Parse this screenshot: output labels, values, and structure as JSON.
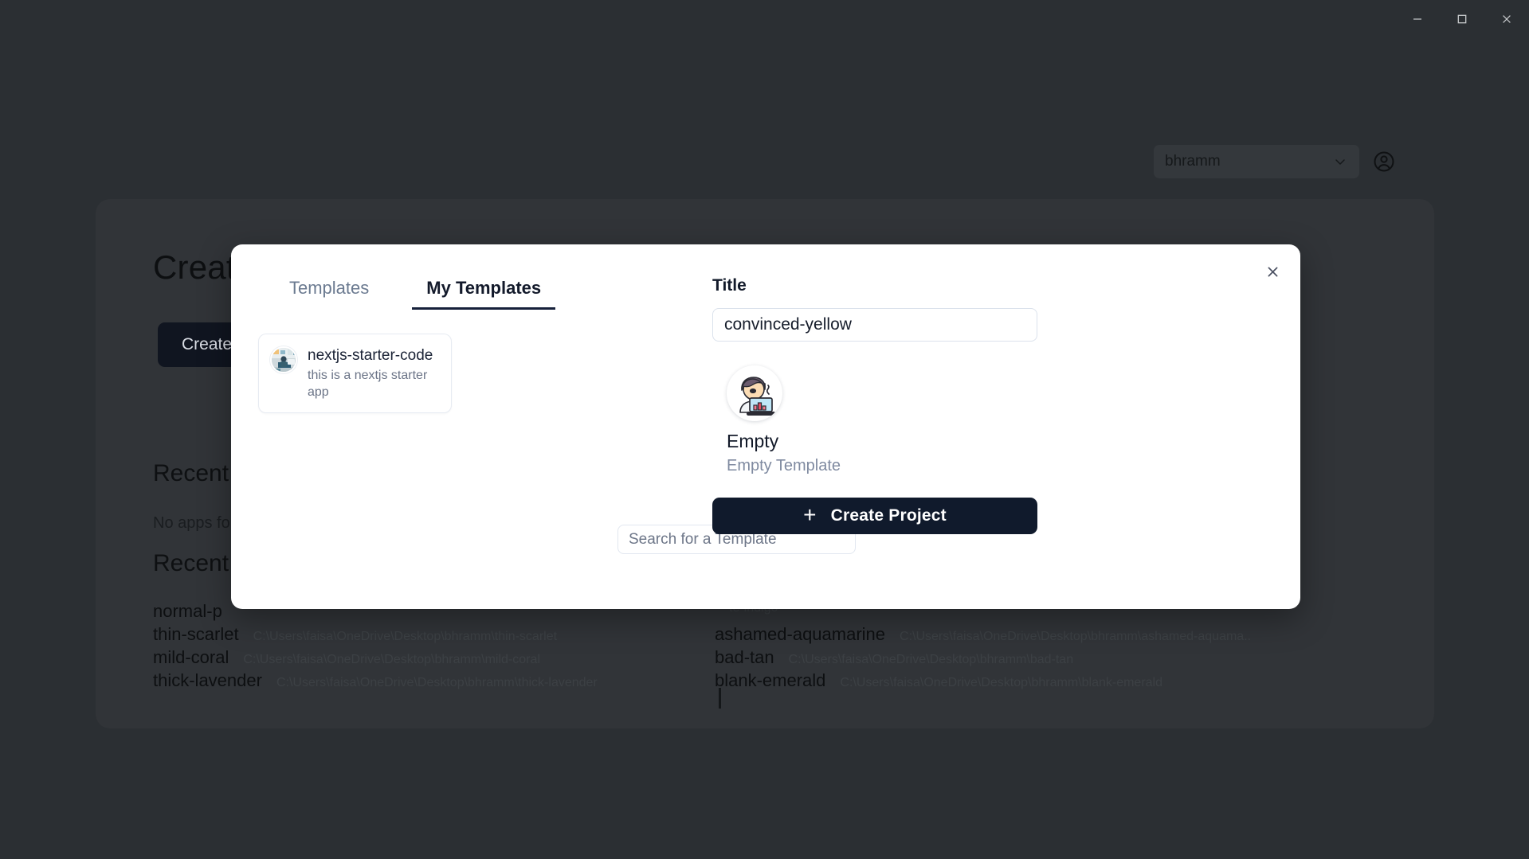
{
  "window": {
    "controls": [
      {
        "name": "minimize",
        "glyph": "minimize-icon"
      },
      {
        "name": "maximize",
        "glyph": "maximize-icon"
      },
      {
        "name": "close",
        "glyph": "close-icon"
      }
    ]
  },
  "account": {
    "org_name": "bhramm",
    "chevron": "chevron-down-icon",
    "avatar": "account-circle-icon"
  },
  "background": {
    "page_title": "Create",
    "create_button_label": "Create",
    "recent_apps_heading": "Recent",
    "no_apps_text": "No apps fo",
    "recent_projects_heading": "Recent",
    "projects_left": [
      {
        "name": "normal-p",
        "path": ""
      },
      {
        "name": "thin-scarlet",
        "path": "C:\\Users\\faisa\\OneDrive\\Desktop\\bhramm\\thin-scarlet"
      },
      {
        "name": "mild-coral",
        "path": "C:\\Users\\faisa\\OneDrive\\Desktop\\bhramm\\mild-coral"
      },
      {
        "name": "thick-lavender",
        "path": "C:\\Users\\faisa\\OneDrive\\Desktop\\bhramm\\thick-lavender"
      }
    ],
    "projects_right": [
      {
        "name": "",
        "path": "te-indigo"
      },
      {
        "name": "ashamed-aquamarine",
        "path": "C:\\Users\\faisa\\OneDrive\\Desktop\\bhramm\\ashamed-aquama.."
      },
      {
        "name": "bad-tan",
        "path": "C:\\Users\\faisa\\OneDrive\\Desktop\\bhramm\\bad-tan"
      },
      {
        "name": "blank-emerald",
        "path": "C:\\Users\\faisa\\OneDrive\\Desktop\\bhramm\\blank-emerald"
      }
    ]
  },
  "modal": {
    "close_icon": "close-icon",
    "tabs": [
      {
        "label": "Templates",
        "active": false
      },
      {
        "label": "My Templates",
        "active": true
      }
    ],
    "search": {
      "placeholder": "Search for a Template",
      "value": ""
    },
    "templates": [
      {
        "name": "nextjs-starter-code",
        "description": "this is a nextjs starter app",
        "thumb": "person-at-desk-thumbnail"
      }
    ],
    "detail": {
      "title_label": "Title",
      "title_value": "convinced-yellow",
      "selected_template_name": "Empty",
      "selected_template_desc": "Empty Template",
      "selected_template_avatar": "person-with-laptop-chart-icon",
      "create_button_label": "Create Project",
      "create_button_plus": "+"
    }
  },
  "colors": {
    "app_background": "#2b2f33",
    "panel_background": "#313438",
    "modal_background": "#ffffff",
    "accent_dark": "#101a2c",
    "tab_active": "#131a2b",
    "tab_inactive": "#6b7a90",
    "muted_text": "#7f8aa0"
  }
}
